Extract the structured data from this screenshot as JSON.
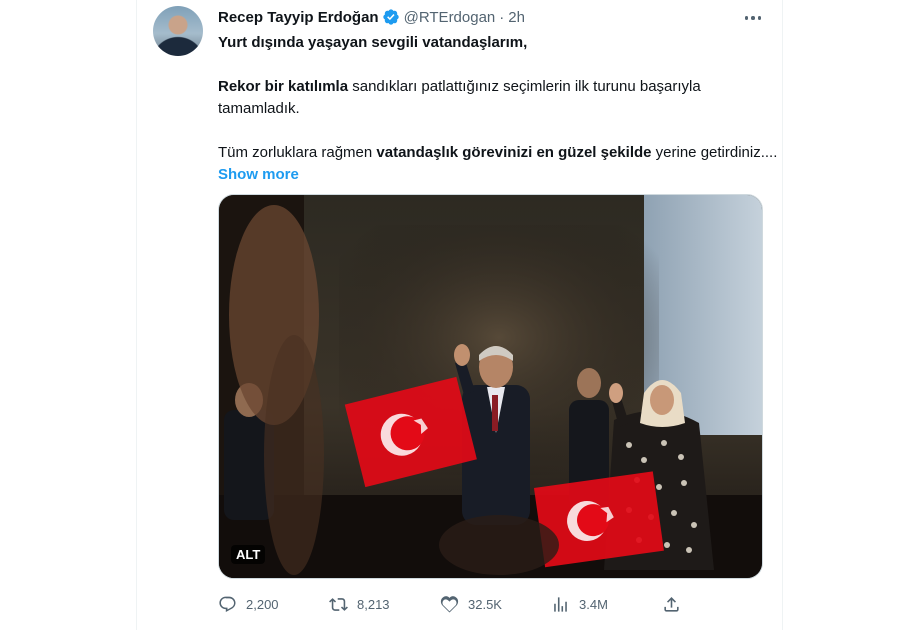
{
  "author": {
    "name": "Recep Tayyip Erdoğan",
    "handle": "@RTErdogan",
    "separator": "·",
    "time": "2h"
  },
  "tweet": {
    "line1": "Yurt dışında yaşayan sevgili vatandaşlarım,",
    "p2_bold": "Rekor bir katılımla",
    "p2_rest": " sandıkları patlattığınız seçimlerin ilk turunu başarıyla tamamladık.",
    "p3_start": "Tüm zorluklara rağmen ",
    "p3_bold": "vatandaşlık görevinizi en güzel şekilde",
    "p3_end": " yerine getirdiniz.... ",
    "show_more": "Show more"
  },
  "media": {
    "alt_badge": "ALT"
  },
  "actions": {
    "replies": "2,200",
    "retweets": "8,213",
    "likes": "32.5K",
    "views": "3.4M"
  },
  "icons": {
    "verified": "verified-badge-icon",
    "more": "more-dots-icon",
    "reply": "reply-icon",
    "retweet": "retweet-icon",
    "like": "heart-icon",
    "views": "views-bar-icon",
    "share": "share-icon"
  },
  "colors": {
    "accent": "#1d9bf0",
    "secondary_text": "#536471",
    "flag_red": "#e30a17"
  }
}
